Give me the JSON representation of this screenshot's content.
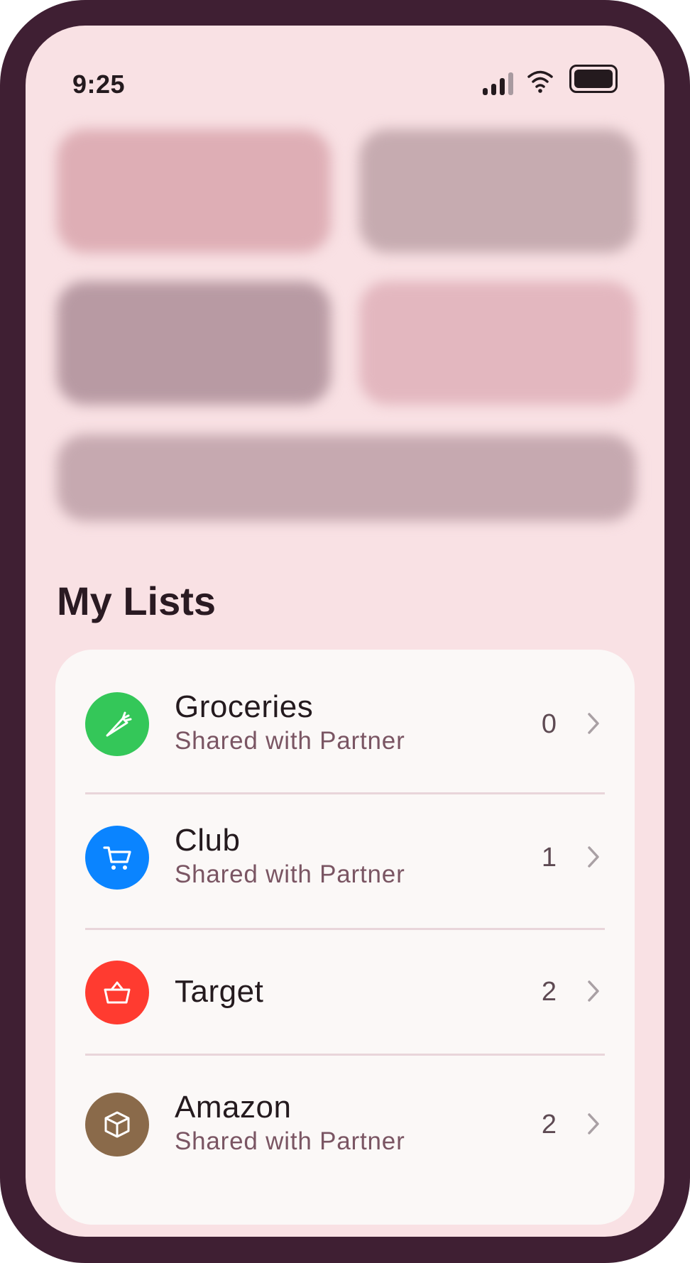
{
  "status_bar": {
    "time": "9:25",
    "icons": [
      "cellular-signal-icon",
      "wifi-icon",
      "battery-icon"
    ]
  },
  "section": {
    "title": "My Lists"
  },
  "lists": [
    {
      "title": "Groceries",
      "subtitle": "Shared with Partner",
      "count": "0",
      "icon": "carrot-icon",
      "color": "#34c759"
    },
    {
      "title": "Club",
      "subtitle": "Shared with Partner",
      "count": "1",
      "icon": "cart-icon",
      "color": "#0a84ff"
    },
    {
      "title": "Target",
      "subtitle": "",
      "count": "2",
      "icon": "basket-icon",
      "color": "#ff3b30"
    },
    {
      "title": "Amazon",
      "subtitle": "Shared with Partner",
      "count": "2",
      "icon": "box-icon",
      "color": "#8a6a4a"
    }
  ],
  "colors": {
    "frame": "#3f1f33",
    "background": "#f9e1e4",
    "card": "#fbf8f7"
  }
}
